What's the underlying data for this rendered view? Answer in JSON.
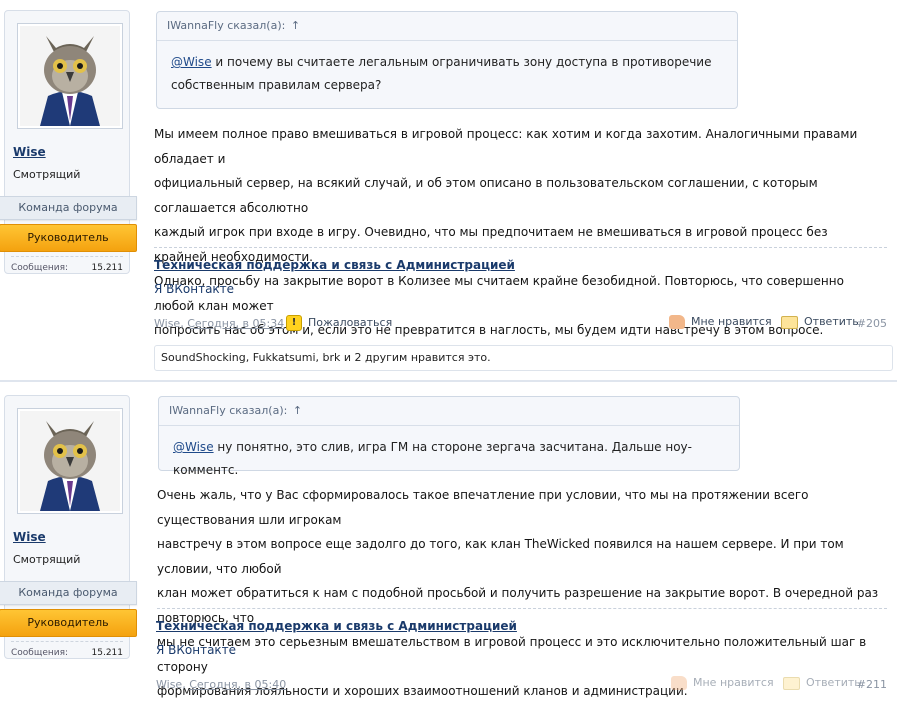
{
  "posts": [
    {
      "user": {
        "name": "Wise",
        "title": "Смотрящий",
        "group": "Команда форума",
        "role": "Руководитель",
        "messages_label": "Сообщения:",
        "messages_count": "15.211"
      },
      "quote": {
        "header": "IWannaFly сказал(а):",
        "arrow": "↑",
        "mention": "@Wise",
        "text": " и почему вы считаете легальным ограничивать зону доступа в противоречие собственным правилам сервера?"
      },
      "message_lines": [
        "Мы имеем полное право вмешиваться в игровой процесс: как хотим и когда захотим. Аналогичными правами обладает и",
        "официальный сервер, на всякий случай, и об этом описано в пользовательском соглашении, с которым соглашается абсолютно",
        "каждый игрок при входе в игру. Очевидно, что мы предпочитаем не вмешиваться в игровой процесс без крайней необходимости.",
        "Однако, просьбу на закрытие ворот в Колизее мы считаем крайне безобидной. Повторюсь, что совершенно любой клан может",
        "попросить нас об этом и, если это не превратится в наглость, мы будем идти навстречу в этом вопросе."
      ],
      "signature": {
        "support_link": "Техническая поддержка и связь с Администрацией",
        "vk_link": "Я ВКонтакте"
      },
      "meta": {
        "author": "Wise,",
        "date": "Сегодня, в 05:34",
        "report": "Пожаловаться",
        "like": "Мне нравится",
        "reply": "Ответить",
        "number": "#205"
      },
      "likes_text": "SoundShocking, Fukkatsumi, brk и 2 другим нравится это."
    },
    {
      "user": {
        "name": "Wise",
        "title": "Смотрящий",
        "group": "Команда форума",
        "role": "Руководитель",
        "messages_label": "Сообщения:",
        "messages_count": "15.211"
      },
      "quote": {
        "header": "IWannaFly сказал(а):",
        "arrow": "↑",
        "mention": "@Wise",
        "text": " ну понятно, это слив, игра ГМ на стороне зергача засчитана. Дальше ноу-комментс."
      },
      "message_lines": [
        "Очень жаль, что у Вас сформировалось такое впечатление при условии, что мы на протяжении всего существования шли игрокам",
        "навстречу в этом вопросе еще задолго до того, как клан TheWicked появился на нашем сервере. И при том условии, что любой",
        "клан может обратиться к нам с подобной просьбой и получить разрешение на закрытие ворот. В очередной раз повторюсь, что",
        "мы не считаем это серьезным вмешательством в игровой процесс и это исключительно положительный шаг в сторону",
        "формирования лояльности и хороших взаимоотношений кланов и администрации."
      ],
      "signature": {
        "support_link": "Техническая поддержка и связь с Администрацией",
        "vk_link": "Я ВКонтакте"
      },
      "meta": {
        "author": "Wise,",
        "date": "Сегодня, в 05:40",
        "like": "Мне нравится",
        "reply": "Ответить",
        "number": "#211"
      }
    }
  ]
}
